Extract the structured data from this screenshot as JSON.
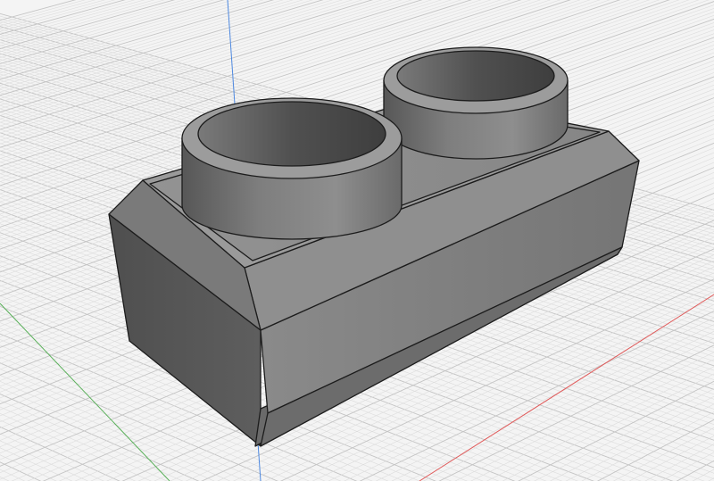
{
  "viewport": {
    "background": "#f4f4f4",
    "grid": {
      "visible": true,
      "minor_color": "#dcdcdc",
      "major_color": "#c4c4c4"
    },
    "axes": {
      "x_axis_color": "#e05a5a",
      "y_axis_color": "#5ab05a",
      "z_axis_color": "#4d88e0"
    }
  },
  "model": {
    "name": "",
    "shape": "2-stud plate with chamfered edges",
    "stud_count": 2,
    "face_colors": {
      "top": "#8c8c8c",
      "front": "#6e6e6e",
      "left": "#555555",
      "edge": "#1c1c1c"
    }
  }
}
